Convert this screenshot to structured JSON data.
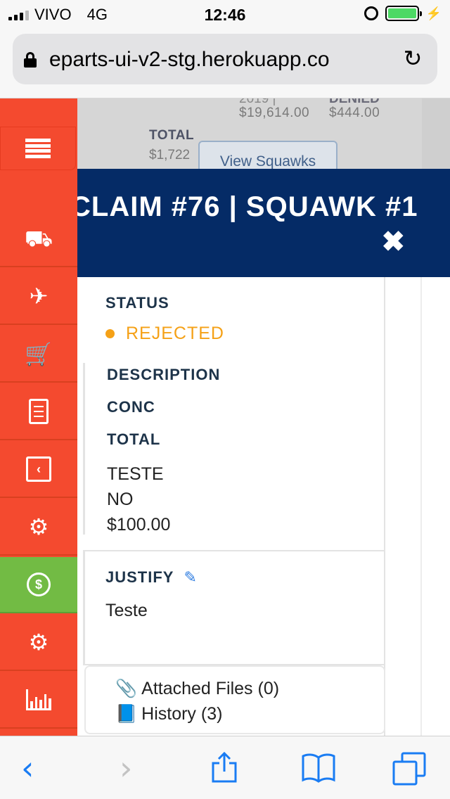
{
  "status_bar": {
    "carrier": "VIVO",
    "network": "4G",
    "time": "12:46"
  },
  "browser": {
    "url": "eparts-ui-v2-stg.herokuapp.co"
  },
  "background_page": {
    "amount_left_clipped": "2019 |",
    "amount_left": "$19,614.00",
    "amount_right_label_clipped": "DENIED",
    "amount_right": "$444.00",
    "total_label": "TOTAL",
    "total_value": "$1,722",
    "view_squawks_button": "View Squawks"
  },
  "sidebar": {
    "items": [
      {
        "icon": "menu-icon"
      },
      {
        "icon": "truck-icon"
      },
      {
        "icon": "airplane-icon"
      },
      {
        "icon": "cart-icon"
      },
      {
        "icon": "document-icon"
      },
      {
        "icon": "return-box-icon"
      },
      {
        "icon": "gear-exchange-icon"
      },
      {
        "icon": "dollar-refresh-icon",
        "active": true,
        "color": "#72bb44"
      },
      {
        "icon": "gears-icon"
      },
      {
        "icon": "bar-chart-icon"
      }
    ],
    "color": "#f44a2f"
  },
  "modal": {
    "title": "CLAIM #76 | SQUAWK #1",
    "header_color": "#052b66",
    "status_label": "STATUS",
    "status_value": "REJECTED",
    "status_color": "#f5a117",
    "description_label": "DESCRIPTION",
    "conc_label": "CONC",
    "total_label": "TOTAL",
    "description_value": "TESTE",
    "conc_value": "NO",
    "total_value": "$100.00",
    "justify_label": "JUSTIFY",
    "justify_value": "Teste",
    "attached_files": "Attached Files (0)",
    "history": "History (3)"
  }
}
